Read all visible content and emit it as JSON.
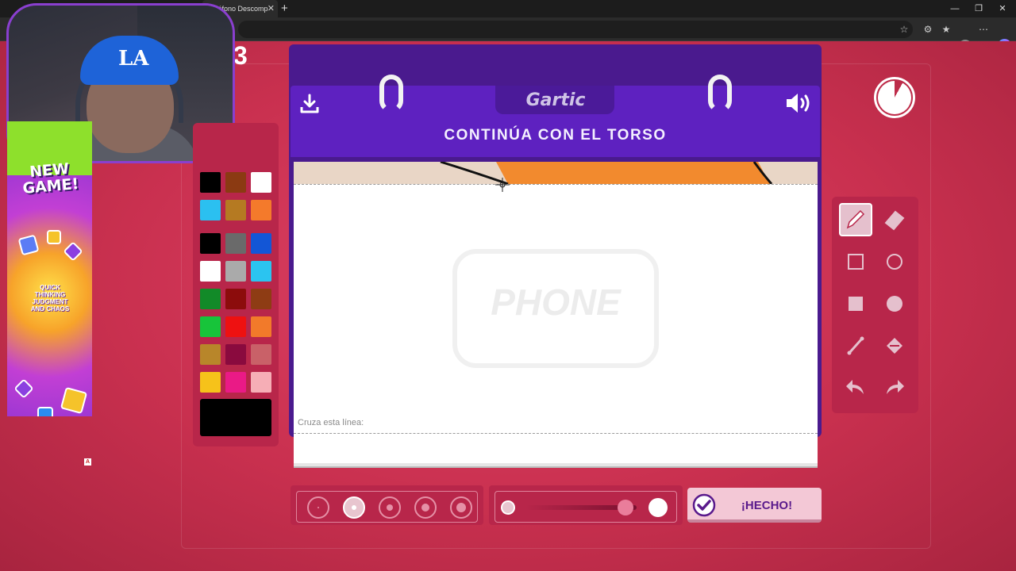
{
  "browser": {
    "tab_title": "Teléfono Descomp",
    "close_glyph": "✕",
    "new_tab_glyph": "+",
    "window_controls": [
      "—",
      "❐",
      "✕"
    ]
  },
  "game": {
    "round_number": "3",
    "instruction": "CONTINÚA CON EL TORSO",
    "logo": "Gartic",
    "watermark": "PHONE",
    "cross_line_label": "Cruza esta línea:",
    "done_label": "¡HECHO!",
    "timer_remaining_fraction": 0.92,
    "accent_color": "#5e21c0",
    "background_color": "#c9304f"
  },
  "ad": {
    "title": "NEW GAME!",
    "subtitle": "QUICK THINKING JUDGMENT AND CHAOS"
  },
  "palette": {
    "colors": [
      "#000000",
      "#8b3a12",
      "#ffffff",
      "#2bc0f0",
      "#b57a22",
      "#f47a2b",
      "#000000",
      "#6a6a6a",
      "#1356d6",
      "#ffffff",
      "#aaaaaa",
      "#2bc4f0",
      "#128a28",
      "#8c0c0c",
      "#8e3c14",
      "#17c43a",
      "#ee1111",
      "#f27a2a",
      "#b8862a",
      "#8a0a3e",
      "#c96168",
      "#f6c21a",
      "#ea1a86",
      "#f6aeb6"
    ],
    "selected_color": "#000000"
  },
  "tools": [
    "pencil-icon",
    "eraser-icon",
    "rectangle-outline-icon",
    "circle-outline-icon",
    "rectangle-filled-icon",
    "circle-filled-icon",
    "line-icon",
    "bucket-icon",
    "undo-icon",
    "redo-icon"
  ],
  "brush_sizes": {
    "count": 5,
    "selected_index": 1
  },
  "opacity_level": 0.9
}
